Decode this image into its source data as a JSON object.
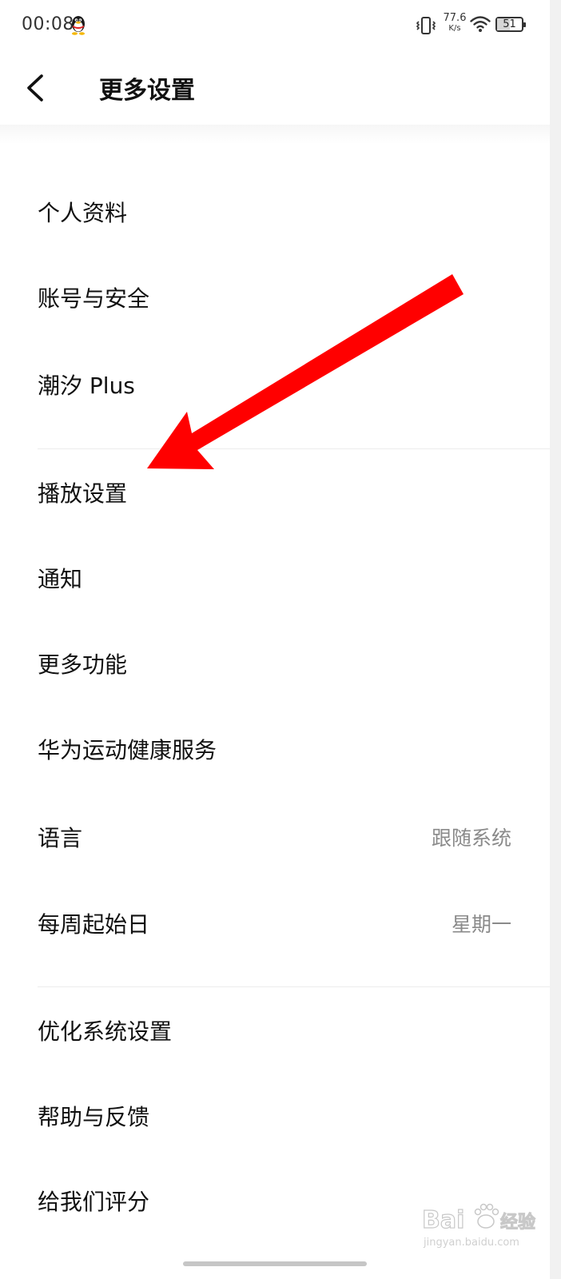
{
  "status_bar": {
    "time": "00:08",
    "net_speed_value": "77.6",
    "net_speed_unit": "K/s",
    "battery_level": "51",
    "battery_fraction": 0.51,
    "icons": [
      "qq-icon",
      "vibrate-icon",
      "wifi-icon",
      "battery-icon"
    ]
  },
  "header": {
    "back_icon": "chevron-left-icon",
    "title": "更多设置"
  },
  "menu": {
    "items": [
      {
        "label": "个人资料"
      },
      {
        "label": "账号与安全"
      },
      {
        "label": "潮汐 Plus"
      },
      {
        "label": "播放设置"
      },
      {
        "label": "通知"
      },
      {
        "label": "更多功能"
      },
      {
        "label": "华为运动健康服务"
      },
      {
        "label": "语言",
        "value": "跟随系统"
      },
      {
        "label": "每周起始日",
        "value": "星期一"
      },
      {
        "label": "优化系统设置"
      },
      {
        "label": "帮助与反馈"
      },
      {
        "label": "给我们评分"
      }
    ]
  },
  "annotation": {
    "arrow_color": "#ff0000"
  },
  "watermark": {
    "brand": "Bai",
    "brand_suffix": "经验",
    "url": "jingyan.baidu.com"
  },
  "colors": {
    "background": "#ffffff",
    "text_primary": "#111111",
    "text_secondary": "#8a8a8a",
    "divider": "#ececec"
  }
}
